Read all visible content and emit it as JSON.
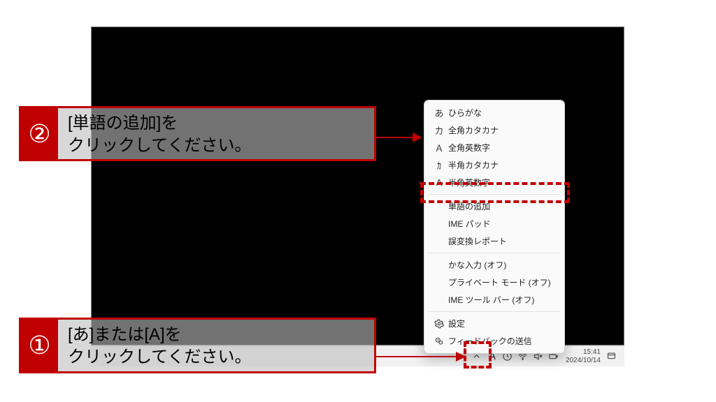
{
  "callouts": {
    "step1": {
      "num": "①",
      "line1": "[あ]または[A]を",
      "line2": "クリックしてください。"
    },
    "step2": {
      "num": "②",
      "line1": "[単語の追加]を",
      "line2": "クリックしてください。"
    }
  },
  "menu": {
    "items": [
      {
        "icon": "あ",
        "label": "ひらがな"
      },
      {
        "icon": "カ",
        "label": "全角カタカナ"
      },
      {
        "icon": "Ａ",
        "label": "全角英数字"
      },
      {
        "icon": "ｶ",
        "label": "半角カタカナ"
      },
      {
        "icon": "A",
        "label": "半角英数字",
        "selected": true
      }
    ],
    "group2": [
      {
        "label": "単語の追加"
      },
      {
        "label": "IME パッド"
      },
      {
        "label": "誤変換レポート"
      }
    ],
    "group3": [
      {
        "label": "かな入力 (オフ)"
      },
      {
        "label": "プライベート モード (オフ)"
      },
      {
        "label": "IME ツール バー (オフ)"
      }
    ],
    "group4": [
      {
        "icon": "gear",
        "label": "設定"
      },
      {
        "icon": "feedback",
        "label": "フィードバックの送信"
      }
    ]
  },
  "taskbar": {
    "ime_mode": "A",
    "time": "15:41",
    "date": "2024/10/14"
  }
}
